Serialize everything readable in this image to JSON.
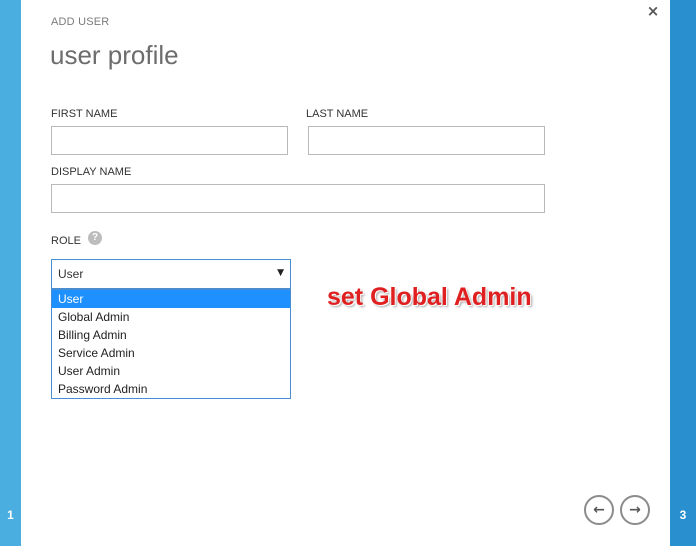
{
  "steps": {
    "left": "1",
    "right": "3"
  },
  "dialog": {
    "breadcrumb": "ADD USER",
    "title": "user profile",
    "close_glyph": "×"
  },
  "form": {
    "first_name": {
      "label": "FIRST NAME",
      "value": ""
    },
    "last_name": {
      "label": "LAST NAME",
      "value": ""
    },
    "display_name": {
      "label": "DISPLAY NAME",
      "value": ""
    },
    "role": {
      "label": "ROLE",
      "help_icon": "help-icon",
      "selected": "User",
      "options": [
        "User",
        "Global Admin",
        "Billing Admin",
        "Service Admin",
        "User Admin",
        "Password Admin"
      ]
    }
  },
  "annotation": "set Global Admin",
  "nav": {
    "prev_icon": "arrow-left-icon",
    "next_icon": "arrow-right-icon"
  },
  "colors": {
    "accent_strip_left": "#4aaee0",
    "accent_strip_right": "#2a8fcf",
    "selection": "#1e90ff",
    "annotation": "#e02020"
  }
}
